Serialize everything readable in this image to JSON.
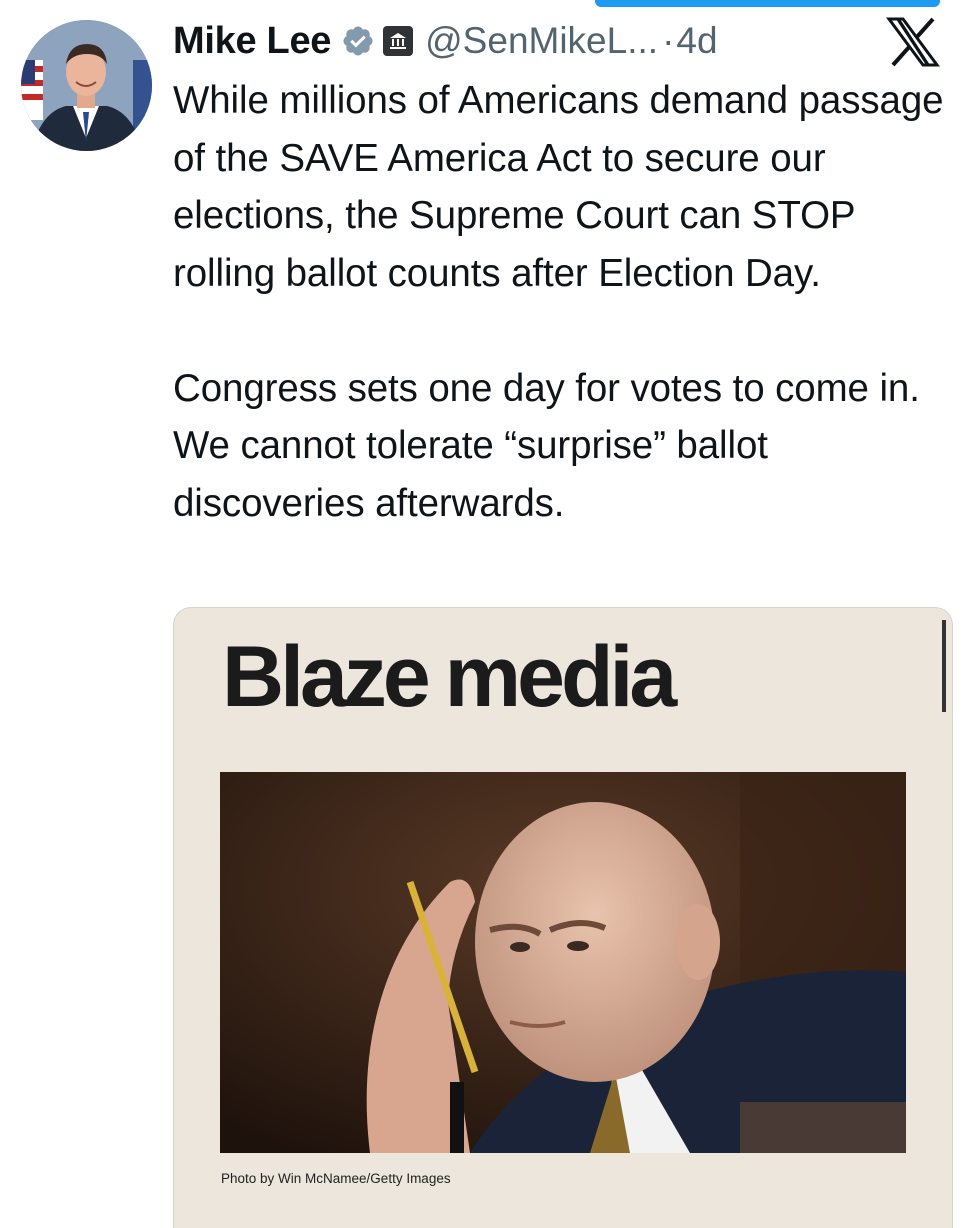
{
  "post": {
    "author_name": "Mike Lee",
    "handle": "@SenMikeL...",
    "separator": "·",
    "time_ago": "4d",
    "badges": [
      "verified-icon",
      "government-building-icon"
    ],
    "platform_logo": "x-logo-icon",
    "paragraphs": [
      "While millions of Americans demand passage of the SAVE America Act to secure our elections, the Supreme Court can STOP rolling ballot counts after Election Day.",
      "Congress sets one day for votes to come in. We cannot tolerate “surprise” ballot discoveries afterwards."
    ]
  },
  "media_card": {
    "brand_word_1": "Blaze",
    "brand_word_2": "media",
    "photo_credit": "Photo by Win McNamee/Getty Images"
  },
  "colors": {
    "verified": "#829aab",
    "secondary_text": "#536471",
    "card_background": "#ece6dc"
  }
}
